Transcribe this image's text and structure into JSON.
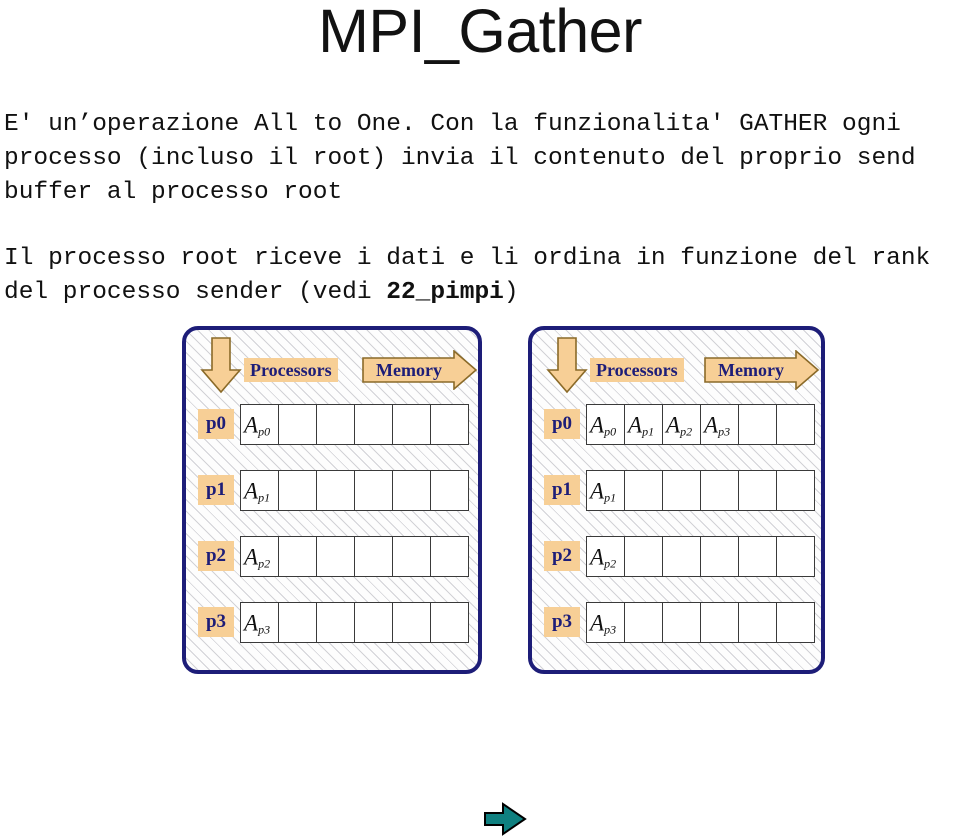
{
  "slide": {
    "title": "MPI_Gather",
    "paragraphs": [
      "E' un’operazione All to One. Con la funzionalita' GATHER ogni processo (incluso il root) invia il contenuto del proprio send buffer al processo root",
      "Il processo root riceve i dati e li ordina in funzione del rank del processo sender (vedi "
    ],
    "paragraph2_bold_ref": "22_pimpi",
    "paragraph2_tail": ")"
  },
  "colors": {
    "panel_border": "#1d1d78",
    "label_fill": "#f7cf96",
    "label_text": "#1d1d78",
    "arrow_fill": "#f7cf96",
    "arrow_outline": "#8a6a28",
    "transfer_arrow": "#0f8080",
    "cell_border": "#3a3a3a",
    "title_text": "#121212",
    "body_text": "#111111"
  },
  "diagram": {
    "transfer_arrow_icon": "right-arrow-icon",
    "panels": [
      {
        "id": "before",
        "header": {
          "down_arrow_icon": "down-arrow-icon",
          "processors_label": "Processors",
          "memory_label": "Memory"
        },
        "rows": [
          {
            "process": "p0",
            "cells": [
              {
                "base": "A",
                "sub": "p0"
              },
              {
                "base": "",
                "sub": ""
              },
              {
                "base": "",
                "sub": ""
              },
              {
                "base": "",
                "sub": ""
              },
              {
                "base": "",
                "sub": ""
              },
              {
                "base": "",
                "sub": ""
              }
            ]
          },
          {
            "process": "p1",
            "cells": [
              {
                "base": "A",
                "sub": "p1"
              },
              {
                "base": "",
                "sub": ""
              },
              {
                "base": "",
                "sub": ""
              },
              {
                "base": "",
                "sub": ""
              },
              {
                "base": "",
                "sub": ""
              },
              {
                "base": "",
                "sub": ""
              }
            ]
          },
          {
            "process": "p2",
            "cells": [
              {
                "base": "A",
                "sub": "p2"
              },
              {
                "base": "",
                "sub": ""
              },
              {
                "base": "",
                "sub": ""
              },
              {
                "base": "",
                "sub": ""
              },
              {
                "base": "",
                "sub": ""
              },
              {
                "base": "",
                "sub": ""
              }
            ]
          },
          {
            "process": "p3",
            "cells": [
              {
                "base": "A",
                "sub": "p3"
              },
              {
                "base": "",
                "sub": ""
              },
              {
                "base": "",
                "sub": ""
              },
              {
                "base": "",
                "sub": ""
              },
              {
                "base": "",
                "sub": ""
              },
              {
                "base": "",
                "sub": ""
              }
            ]
          }
        ]
      },
      {
        "id": "after",
        "header": {
          "down_arrow_icon": "down-arrow-icon",
          "processors_label": "Processors",
          "memory_label": "Memory"
        },
        "rows": [
          {
            "process": "p0",
            "cells": [
              {
                "base": "A",
                "sub": "p0"
              },
              {
                "base": "A",
                "sub": "p1"
              },
              {
                "base": "A",
                "sub": "p2"
              },
              {
                "base": "A",
                "sub": "p3"
              },
              {
                "base": "",
                "sub": ""
              },
              {
                "base": "",
                "sub": ""
              }
            ]
          },
          {
            "process": "p1",
            "cells": [
              {
                "base": "A",
                "sub": "p1"
              },
              {
                "base": "",
                "sub": ""
              },
              {
                "base": "",
                "sub": ""
              },
              {
                "base": "",
                "sub": ""
              },
              {
                "base": "",
                "sub": ""
              },
              {
                "base": "",
                "sub": ""
              }
            ]
          },
          {
            "process": "p2",
            "cells": [
              {
                "base": "A",
                "sub": "p2"
              },
              {
                "base": "",
                "sub": ""
              },
              {
                "base": "",
                "sub": ""
              },
              {
                "base": "",
                "sub": ""
              },
              {
                "base": "",
                "sub": ""
              },
              {
                "base": "",
                "sub": ""
              }
            ]
          },
          {
            "process": "p3",
            "cells": [
              {
                "base": "A",
                "sub": "p3"
              },
              {
                "base": "",
                "sub": ""
              },
              {
                "base": "",
                "sub": ""
              },
              {
                "base": "",
                "sub": ""
              },
              {
                "base": "",
                "sub": ""
              },
              {
                "base": "",
                "sub": ""
              }
            ]
          }
        ]
      }
    ]
  }
}
